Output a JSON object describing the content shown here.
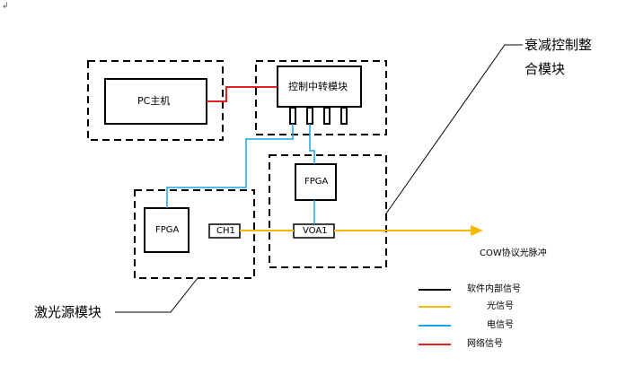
{
  "colors": {
    "software": "#000000",
    "optical": "#f5b800",
    "electrical": "#1aa3e8",
    "network": "#e02020"
  },
  "corner_mark": "↲",
  "blocks": {
    "pc": "PC主机",
    "relay": "控制中转模块",
    "fpga_attn": "FPGA",
    "fpga_laser": "FPGA",
    "ch1": "CH1",
    "voa1": "VOA1"
  },
  "callouts": {
    "attenuation_line1": "衰减控制整",
    "attenuation_line2": "合模块",
    "laser": "激光源模块"
  },
  "output_label": "COW协议光脉冲",
  "legend": [
    {
      "label": "软件内部信号",
      "color": "#000000"
    },
    {
      "label": "光信号",
      "color": "#f5b800"
    },
    {
      "label": "电信号",
      "color": "#1aa3e8"
    },
    {
      "label": "网络信号",
      "color": "#e02020"
    }
  ]
}
